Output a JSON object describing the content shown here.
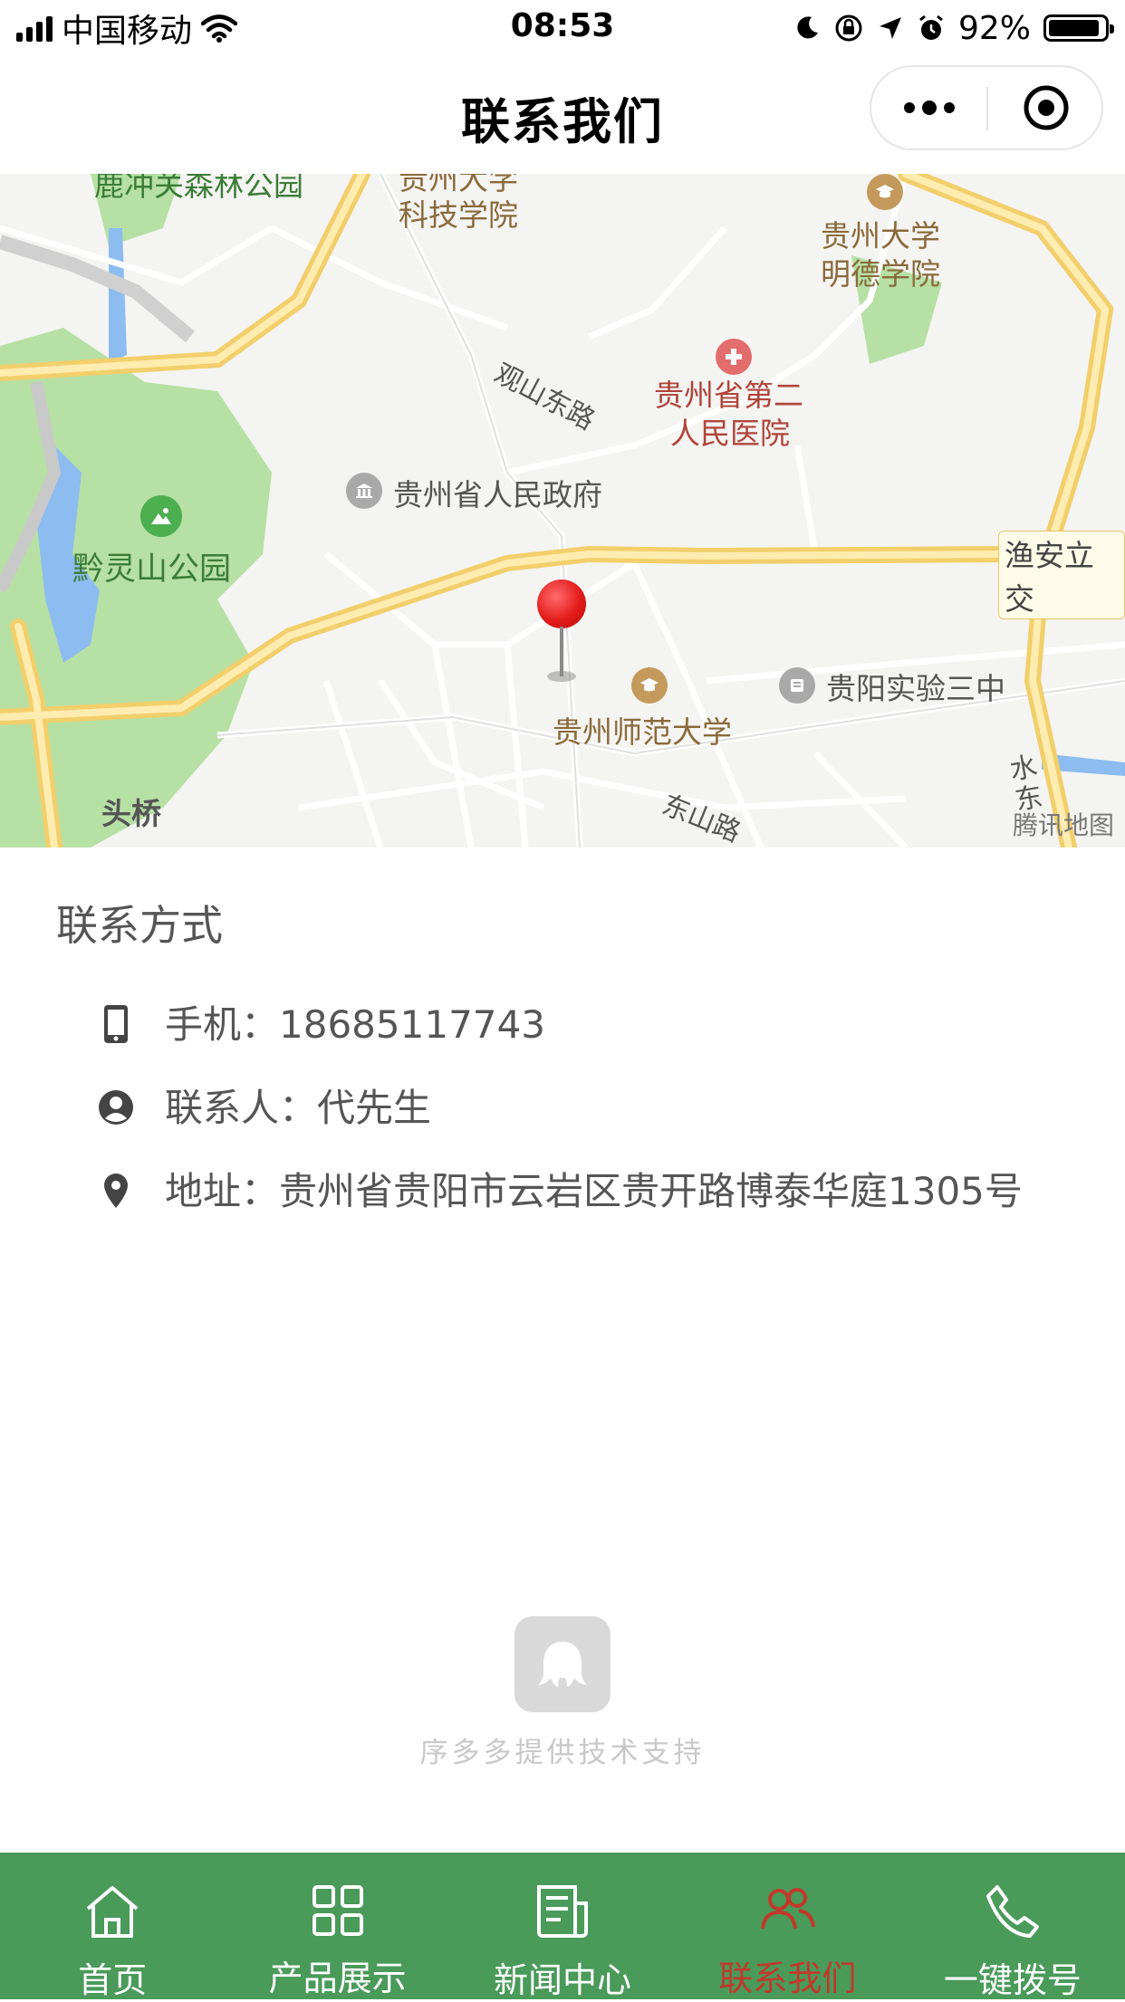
{
  "status_bar": {
    "carrier": "中国移动",
    "time": "08:53",
    "battery": "92%",
    "battery_level": 0.92
  },
  "nav": {
    "title": "联系我们"
  },
  "map": {
    "labels": {
      "top_left_park": "鹿冲关森林公园",
      "college": "贵州大学科技学院",
      "mingde_1": "贵州大学",
      "mingde_2": "明德学院",
      "guanshan_road": "观山东路",
      "hospital_1": "贵州省第二",
      "hospital_2": "人民医院",
      "gov": "贵州省人民政府",
      "qianling_park": "黔灵山公园",
      "yuan_box": "渔安立交",
      "normal_univ": "贵州师范大学",
      "school3": "贵阳实验三中",
      "toutiao": "头桥",
      "dongshan_road": "东山路",
      "shuidong": "水东",
      "copyright": "腾讯地图"
    }
  },
  "contact": {
    "section_title": "联系方式",
    "phone_label": "手机：",
    "phone_value": "18685117743",
    "person_label": "联系人：",
    "person_value": "代先生",
    "address_label": "地址：",
    "address_value": "贵州省贵阳市云岩区贵开路博泰华庭1305号"
  },
  "credit": {
    "text": "序多多提供技术支持"
  },
  "tabs": [
    {
      "label": "首页",
      "icon": "home-icon",
      "active": false
    },
    {
      "label": "产品展示",
      "icon": "grid-icon",
      "active": false
    },
    {
      "label": "新闻中心",
      "icon": "news-icon",
      "active": false
    },
    {
      "label": "联系我们",
      "icon": "contact-icon",
      "active": true
    },
    {
      "label": "一键拨号",
      "icon": "phone-icon",
      "active": false
    }
  ],
  "colors": {
    "tab_bar": "#4a9a5a",
    "active_tab": "#c0392b",
    "pin": "#e41b1b"
  }
}
